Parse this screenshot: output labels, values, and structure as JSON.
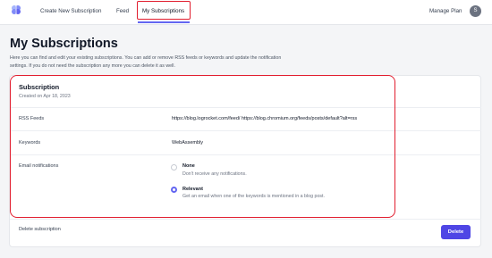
{
  "nav": {
    "logo_icon": "brain-logo-icon",
    "links": [
      "Create New Subscription",
      "Feed",
      "My Subscriptions"
    ],
    "active": "My Subscriptions",
    "manage_plan": "Manage Plan",
    "avatar_letter": "S"
  },
  "page": {
    "title": "My Subscriptions",
    "description": "Here you can find and edit your existing subscriptions. You can add or remove RSS feeds or keywords and update the notification settings. If you do not need the subscription any more you can delete it as well."
  },
  "subscription": {
    "title": "Subscription",
    "created": "Created on Apr 18, 2023",
    "rss_label": "RSS Feeds",
    "rss_value": "https://blog.logrocket.com/feed/ https://blog.chromium.org/feeds/posts/default?alt=rss",
    "keywords_label": "Keywords",
    "keywords_value": "WebAssembly",
    "email_label": "Email notifications",
    "options": [
      {
        "title": "None",
        "desc": "Don't receive any notifications.",
        "selected": false
      },
      {
        "title": "Relevant",
        "desc": "Get an email when one of the keywords is mentioned in a blog post.",
        "selected": true
      }
    ],
    "delete_label": "Delete subscription",
    "delete_button": "Delete"
  },
  "colors": {
    "accent": "#4f46e5",
    "highlight": "#e11d2e"
  }
}
